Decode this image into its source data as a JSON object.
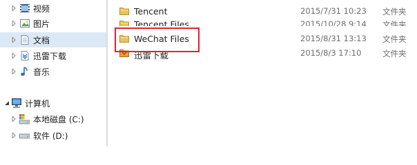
{
  "sidebar": {
    "libraries": [
      {
        "label": "视频",
        "icon": "video-library-icon"
      },
      {
        "label": "图片",
        "icon": "picture-library-icon"
      },
      {
        "label": "文档",
        "icon": "document-library-icon",
        "selected": true
      },
      {
        "label": "迅雷下载",
        "icon": "xunlei-download-library-icon"
      },
      {
        "label": "音乐",
        "icon": "music-library-icon"
      }
    ],
    "computer": {
      "label": "计算机",
      "icon": "computer-icon"
    },
    "drives": [
      {
        "label": "本地磁盘 (C:)",
        "icon": "local-disk-icon"
      },
      {
        "label": "软件 (D:)",
        "icon": "drive-icon"
      }
    ]
  },
  "files": [
    {
      "name": "Tencent",
      "date": "2015/7/31 10:23",
      "type": "文件夹"
    },
    {
      "name": "Tencent Files",
      "date": "2015/10/28 9:14",
      "type": "文件夹"
    },
    {
      "name": "WeChat Files",
      "date": "2015/8/31 13:13",
      "type": "文件夹",
      "highlighted": true
    },
    {
      "name": "迅雷下载",
      "date": "2015/8/3 17:10",
      "type": "文件夹"
    }
  ],
  "colors": {
    "selection": "#dbe8f5",
    "highlight_border": "#e8202a",
    "folder": "#e8c25a"
  }
}
